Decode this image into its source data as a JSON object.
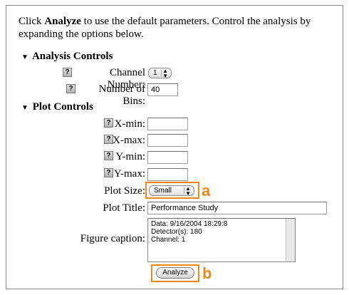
{
  "intro": {
    "prefix": "Click ",
    "bold": "Analyze",
    "suffix": " to use the default parameters. Control the analysis by expanding the options below."
  },
  "help_glyph": "?",
  "sections": {
    "analysis": {
      "title": "Analysis Controls",
      "expander": "▼"
    },
    "plot": {
      "title": "Plot Controls",
      "expander": "▼"
    }
  },
  "fields": {
    "channel": {
      "label": "Channel Number:",
      "value": "1"
    },
    "bins": {
      "label": "Number of Bins:",
      "value": "40"
    },
    "xmin": {
      "label": "X-min:",
      "value": ""
    },
    "xmax": {
      "label": "X-max:",
      "value": ""
    },
    "ymin": {
      "label": "Y-min:",
      "value": ""
    },
    "ymax": {
      "label": "Y-max:",
      "value": ""
    },
    "plot_size": {
      "label": "Plot Size:",
      "value": "Small"
    },
    "plot_title": {
      "label": "Plot Title:",
      "value": "Performance Study"
    },
    "caption": {
      "label": "Figure caption:",
      "lines": [
        "Data: 9/16/2004 18:29:8",
        "Detector(s): 180",
        "Channel: 1"
      ]
    }
  },
  "select_arrows": {
    "up": "▲",
    "down": "▼"
  },
  "analyze_button": "Analyze",
  "callouts": {
    "a": "a",
    "b": "b"
  },
  "highlight_color": "#f0871c"
}
